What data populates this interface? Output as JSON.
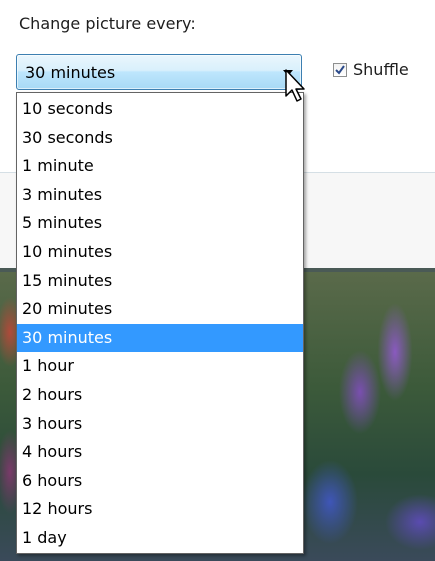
{
  "heading": "Change picture every:",
  "combo": {
    "value": "30 minutes"
  },
  "shuffle": {
    "label": "Shuffle",
    "checked": true
  },
  "dropdown": {
    "selected_index": 8,
    "options": [
      "10 seconds",
      "30 seconds",
      "1 minute",
      "3 minutes",
      "5 minutes",
      "10 minutes",
      "15 minutes",
      "20 minutes",
      "30 minutes",
      "1 hour",
      "2 hours",
      "3 hours",
      "4 hours",
      "6 hours",
      "12 hours",
      "1 day"
    ]
  },
  "colors": {
    "selection": "#3399ff",
    "combo_border": "#3c7fb1"
  },
  "icons": {
    "dropdown_arrow": "chevron-down-icon",
    "cursor": "mouse-pointer-icon",
    "check": "checkmark-icon"
  }
}
